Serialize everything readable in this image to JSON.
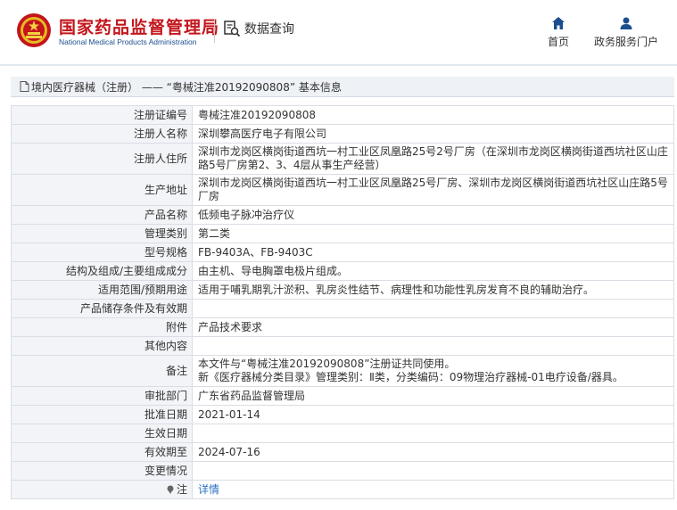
{
  "header": {
    "brand_cn": "国家药品监督管理局",
    "brand_en": "National Medical Products Administration",
    "query_label": "数据查询",
    "nav": [
      {
        "label": "首页",
        "icon": "home-icon"
      },
      {
        "label": "政务服务门户",
        "icon": "user-icon"
      }
    ],
    "brand_color": "#c3161c",
    "accent_color": "#1b4e8e"
  },
  "breadcrumb": "境内医疗器械（注册） —— “粤械注准20192090808” 基本信息",
  "rows": [
    {
      "key": "注册证编号",
      "value": "粤械注准20192090808"
    },
    {
      "key": "注册人名称",
      "value": "深圳攀高医疗电子有限公司"
    },
    {
      "key": "注册人住所",
      "value": "深圳市龙岗区横岗街道西坑一村工业区凤凰路25号2号厂房（在深圳市龙岗区横岗街道西坑社区山庄路5号厂房第2、3、4层从事生产经营）"
    },
    {
      "key": "生产地址",
      "value": "深圳市龙岗区横岗街道西坑一村工业区凤凰路25号厂房、深圳市龙岗区横岗街道西坑社区山庄路5号厂房"
    },
    {
      "key": "产品名称",
      "value": "低频电子脉冲治疗仪"
    },
    {
      "key": "管理类别",
      "value": "第二类"
    },
    {
      "key": "型号规格",
      "value": "FB-9403A、FB-9403C"
    },
    {
      "key": "结构及组成/主要组成成分",
      "value": "由主机、导电胸罩电极片组成。"
    },
    {
      "key": "适用范围/预期用途",
      "value": "适用于哺乳期乳汁淤积、乳房炎性结节、病理性和功能性乳房发育不良的辅助治疗。"
    },
    {
      "key": "产品储存条件及有效期",
      "value": ""
    },
    {
      "key": "附件",
      "value": "产品技术要求"
    },
    {
      "key": "其他内容",
      "value": ""
    },
    {
      "key": "备注",
      "value": "本文件与“粤械注准20192090808”注册证共同使用。",
      "value2": "新《医疗器械分类目录》管理类别：Ⅱ类，分类编码：09物理治疗器械-01电疗设备/器具。"
    },
    {
      "key": "审批部门",
      "value": "广东省药品监督管理局"
    },
    {
      "key": "批准日期",
      "value": "2021-01-14"
    },
    {
      "key": "生效日期",
      "value": ""
    },
    {
      "key": "有效期至",
      "value": "2024-07-16"
    },
    {
      "key": "变更情况",
      "value": ""
    }
  ],
  "note": {
    "key": "注",
    "link": "详情"
  }
}
